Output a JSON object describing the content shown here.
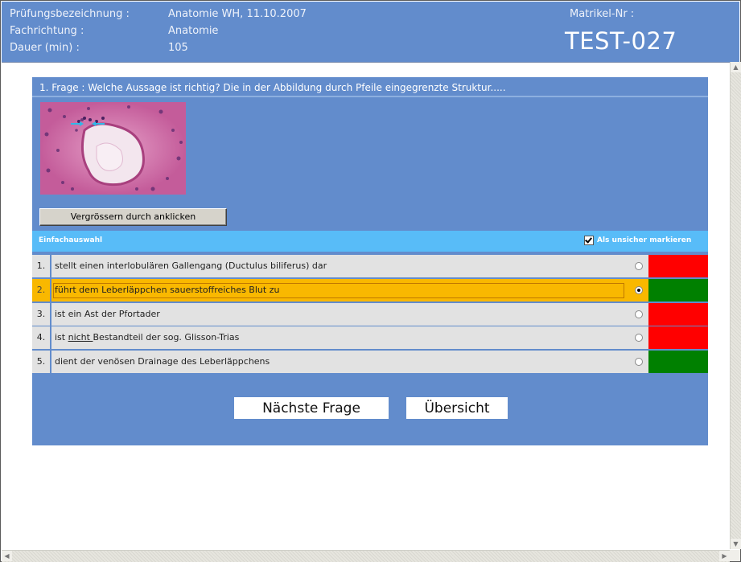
{
  "header": {
    "exam_label": "Prüfungsbezeichnung :",
    "exam_value": "Anatomie WH, 11.10.2007",
    "field_label": "Fachrichtung :",
    "field_value": "Anatomie",
    "duration_label": "Dauer (min) :",
    "duration_value": "105",
    "matrikel_label": "Matrikel-Nr :",
    "matrikel_value": "TEST-027"
  },
  "question": {
    "title": "1. Frage : Welche Aussage ist richtig? Die in der Abbildung durch Pfeile eingegrenzte Struktur.....",
    "image_icon": "histology-image",
    "enlarge_label": "Vergrössern durch anklicken",
    "mode_label": "Einfachauswahl",
    "unsure_label": "Als unsicher markieren",
    "unsure_checked": true
  },
  "answers": [
    {
      "num": "1.",
      "text": "stellt einen interlobulären Gallengang (Ductulus biliferus) dar",
      "selected": false,
      "feedback_color": "#ff0000"
    },
    {
      "num": "2.",
      "text": "führt dem Leberläppchen sauerstoffreiches Blut zu",
      "selected": true,
      "feedback_color": "#008000"
    },
    {
      "num": "3.",
      "text": "ist ein Ast der Pfortader",
      "selected": false,
      "feedback_color": "#ff0000"
    },
    {
      "num": "4.",
      "text_underlined": "nicht ",
      "text_prefix": "ist ",
      "text_suffix": "Bestandteil der sog. Glisson-Trias",
      "selected": false,
      "feedback_color": "#ff0000"
    },
    {
      "num": "5.",
      "text": "dient der venösen Drainage des Leberläppchens",
      "selected": false,
      "feedback_color": "#008000"
    }
  ],
  "buttons": {
    "next_label": "Nächste Frage",
    "overview_label": "Übersicht"
  },
  "colors": {
    "panel": "#628ccc",
    "subheader": "#58bcf8",
    "selected_row": "#f9b800",
    "wrong": "#ff0000",
    "right": "#008000"
  }
}
